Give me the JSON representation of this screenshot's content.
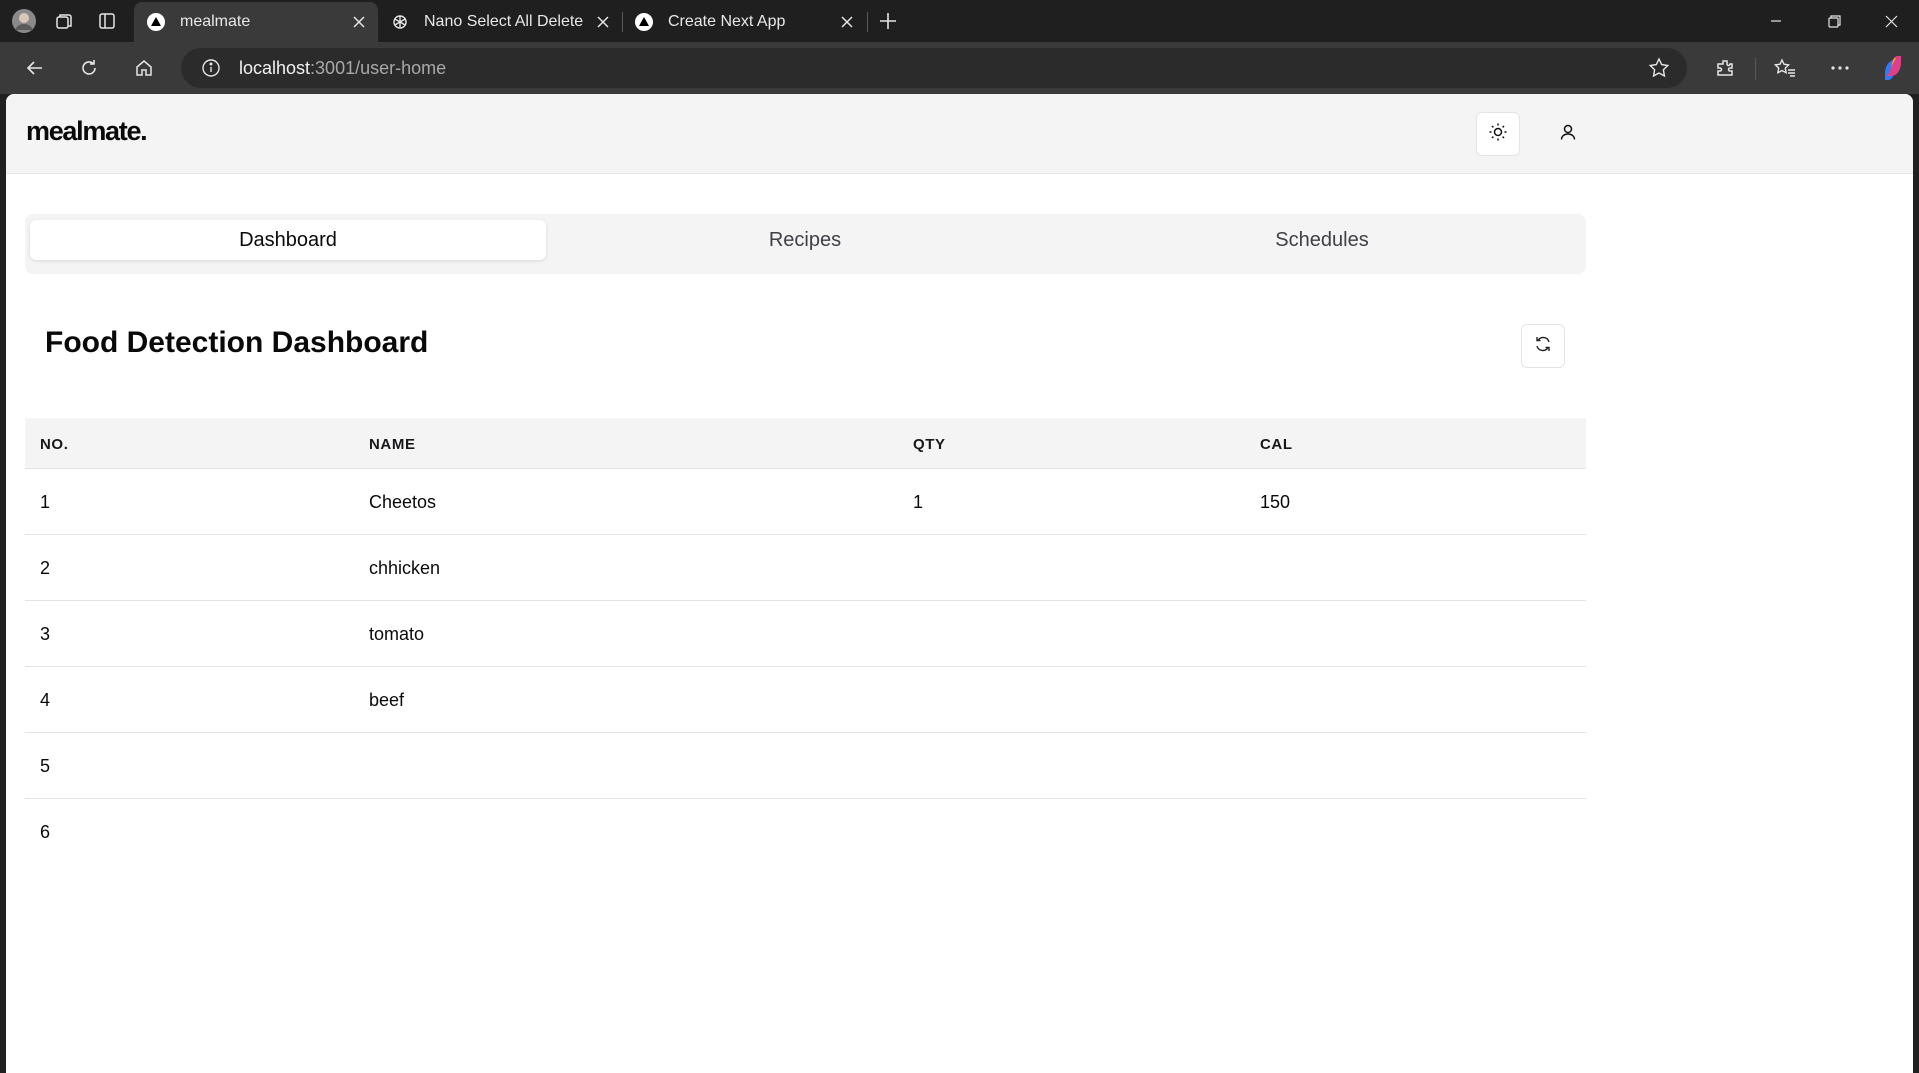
{
  "browser": {
    "tabs": [
      {
        "title": "mealmate",
        "active": true
      },
      {
        "title": "Nano Select All Delete",
        "active": false
      },
      {
        "title": "Create Next App",
        "active": false
      }
    ],
    "address": {
      "host": "localhost",
      "path": ":3001/user-home"
    }
  },
  "app": {
    "logo": "mealmate.",
    "nav_tabs": [
      {
        "label": "Dashboard",
        "selected": true
      },
      {
        "label": "Recipes",
        "selected": false
      },
      {
        "label": "Schedules",
        "selected": false
      }
    ],
    "title": "Food Detection Dashboard",
    "table": {
      "headers": [
        "NO.",
        "NAME",
        "QTY",
        "CAL"
      ],
      "rows": [
        [
          "1",
          "Cheetos",
          "1",
          "150"
        ],
        [
          "2",
          "chhicken",
          "",
          ""
        ],
        [
          "3",
          "tomato",
          "",
          ""
        ],
        [
          "4",
          "beef",
          "",
          ""
        ],
        [
          "5",
          "",
          "",
          ""
        ],
        [
          "6",
          "",
          "",
          ""
        ]
      ]
    }
  },
  "colors": {
    "chrome_dark": "#1f1f1f",
    "toolbar": "#3a3a3a",
    "page_bg": "#ffffff",
    "muted_bg": "#f4f4f5"
  },
  "icons": [
    "profile-avatar-icon",
    "workspaces-icon",
    "tab-actions-icon",
    "favicon-triangle-icon",
    "openai-icon",
    "close-icon",
    "new-tab-icon",
    "minimize-icon",
    "restore-icon",
    "back-icon",
    "reload-icon",
    "home-icon",
    "info-icon",
    "star-icon",
    "extensions-icon",
    "favorites-icon",
    "more-icon",
    "copilot-icon",
    "sun-icon",
    "user-icon",
    "refresh-icon"
  ]
}
